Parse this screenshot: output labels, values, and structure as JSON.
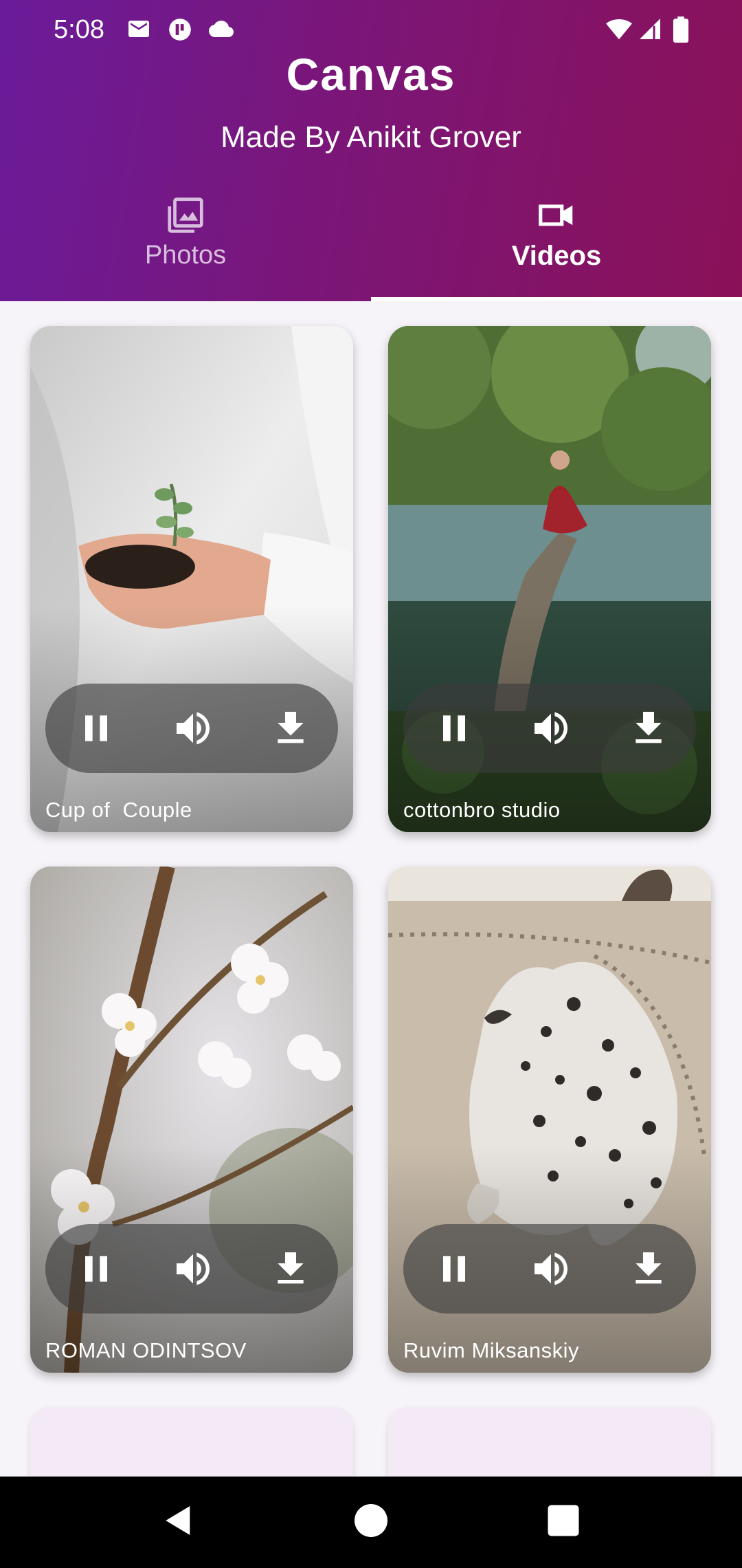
{
  "status_bar": {
    "time": "5:08",
    "left_icons": [
      "gmail-icon",
      "app-notification-icon",
      "cloud-icon"
    ],
    "right_icons": [
      "wifi-icon",
      "cell-signal-icon",
      "battery-icon"
    ]
  },
  "header": {
    "title": "Canvas",
    "subtitle": "Made By Anikit Grover",
    "gradient_colors": [
      "#6A1B9A",
      "#8A1158"
    ]
  },
  "tabs": [
    {
      "label": "Photos",
      "icon": "photo-library-icon",
      "selected": false
    },
    {
      "label": "Videos",
      "icon": "videocam-icon",
      "selected": true
    }
  ],
  "videos": [
    {
      "credit": "Cup of  Couple",
      "thumbnail": "hands holding soil with a seedling",
      "playing": true
    },
    {
      "credit": "cottonbro studio",
      "thumbnail": "person meditating on a tree over a river",
      "playing": true
    },
    {
      "credit": "ROMAN ODINTSOV",
      "thumbnail": "white cherry blossoms on a branch",
      "playing": true
    },
    {
      "credit": "Ruvim Miksanskiy",
      "thumbnail": "seal pup on a sandy beach",
      "playing": true
    }
  ],
  "video_controls": [
    "pause-icon",
    "volume-icon",
    "download-icon"
  ],
  "nav_bar": [
    "back-button",
    "home-button",
    "recents-button"
  ]
}
